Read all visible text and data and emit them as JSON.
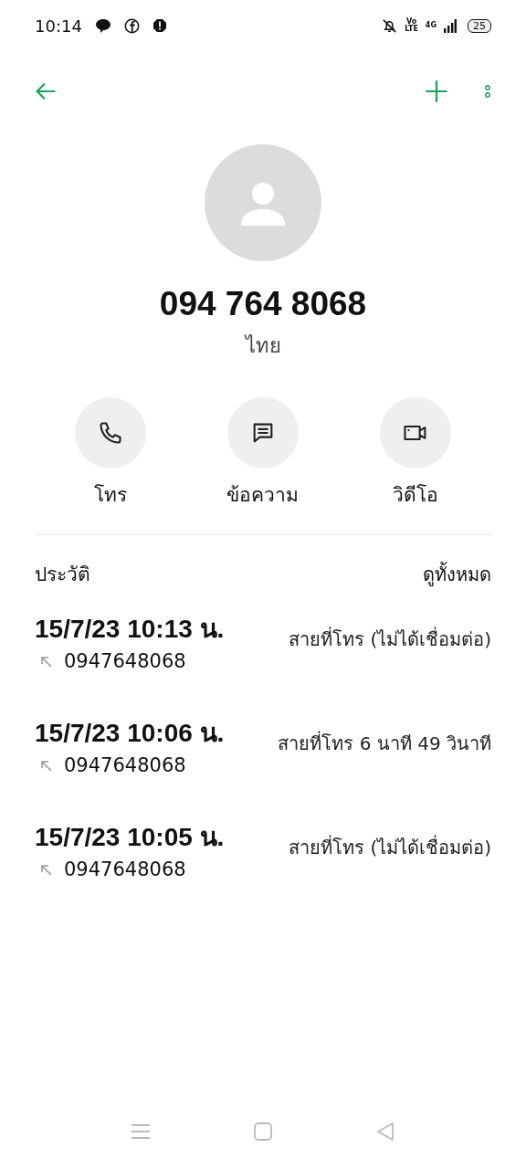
{
  "status_bar": {
    "time": "10:14",
    "volte": [
      "Vo",
      "LTE"
    ],
    "network": "4G",
    "battery": "25"
  },
  "contact": {
    "number": "094 764 8068",
    "location": "ไทย"
  },
  "actions": [
    {
      "kind": "call",
      "label": "โทร"
    },
    {
      "kind": "message",
      "label": "ข้อความ"
    },
    {
      "kind": "video",
      "label": "วิดีโอ"
    }
  ],
  "history": {
    "title": "ประวัติ",
    "view_all": "ดูทั้งหมด",
    "calls": [
      {
        "datetime": "15/7/23 10:13 น.",
        "number": "0947648068",
        "status": "สายที่โทร (ไม่ได้เชื่อมต่อ)"
      },
      {
        "datetime": "15/7/23 10:06 น.",
        "number": "0947648068",
        "status": "สายที่โทร  6 นาที 49 วินาที"
      },
      {
        "datetime": "15/7/23 10:05 น.",
        "number": "0947648068",
        "status": "สายที่โทร (ไม่ได้เชื่อมต่อ)"
      }
    ]
  }
}
